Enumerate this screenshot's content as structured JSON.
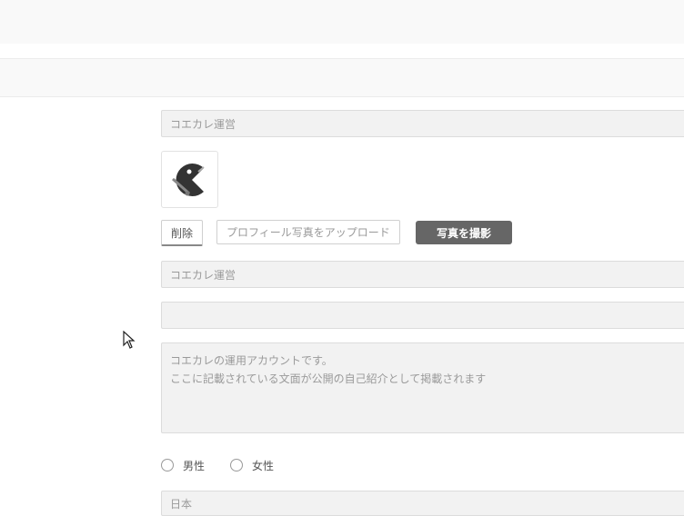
{
  "profile": {
    "display_name": "コエカレ運営",
    "delete_label": "削除",
    "upload_placeholder": "プロフィール写真をアップロード",
    "take_photo_label": "写真を撮影",
    "account_name": "コエカレ運営",
    "extra_field": "",
    "bio_line1": "コエカレの運用アカウントです。",
    "bio_line2": "ここに記載されている文面が公開の自己紹介として掲載されます",
    "gender_male": "男性",
    "gender_female": "女性",
    "country": "日本"
  }
}
